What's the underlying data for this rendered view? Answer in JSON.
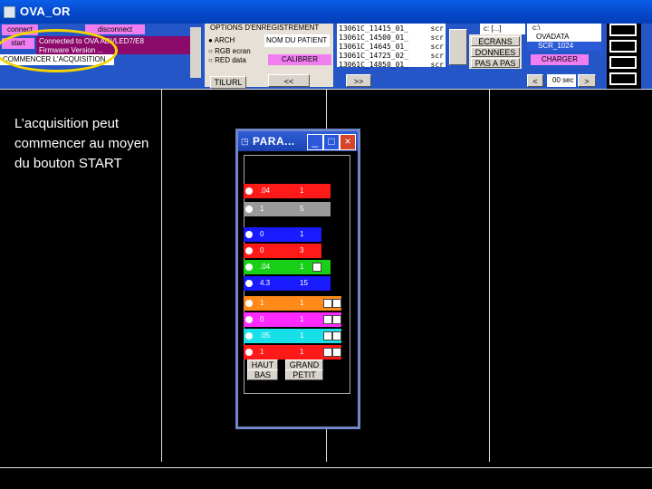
{
  "app": {
    "title": "OVA_OR"
  },
  "toolbar": {
    "connect": "connect",
    "start": "start",
    "disconnect": "disconnect",
    "status_lines": [
      "Connected to OVA  ADVLED7/E8",
      "Firmware Version ..."
    ],
    "status_bottom": "COMMENCER L'ACQUISITION",
    "options_title": "OPTIONS D'ENREGISTREMENT",
    "radio_options": [
      "ARCH",
      "RGB ecran",
      "RED data"
    ],
    "nom_patient": "NOM DU PATIENT",
    "calibrer": "CALIBRER",
    "file_list": [
      {
        "name": "13061C_11415_01_",
        "ext": "scr"
      },
      {
        "name": "13061C_14500_01_",
        "ext": "scr"
      },
      {
        "name": "13061C_14645_01_",
        "ext": "scr"
      },
      {
        "name": "13061C_14725_02_",
        "ext": "scr"
      },
      {
        "name": "13061C_14850_01_",
        "ext": "scr"
      }
    ],
    "ecrans": "ECRANS",
    "donnees": "DONNEES",
    "pas_a_pas": "PAS A PAS",
    "drive": "c: [...]",
    "folders": [
      "c:\\",
      "OVADATA",
      "SCR_1024"
    ],
    "charger": "CHARGER",
    "nav_prev": "<<",
    "nav_next": ">>",
    "lt": "<",
    "gt": ">",
    "seconds": "00 sec",
    "title_field": "TILURL"
  },
  "note": "L’acquisition peut commencer au moyen du bouton START",
  "para": {
    "title": "PARA...",
    "rows": [
      {
        "a": ".04",
        "b": "1",
        "color": "#ff1a1a",
        "width": 96,
        "radio": true,
        "checks": 0
      },
      {
        "a": "1",
        "b": "5",
        "color": "#9a9a9a",
        "width": 96,
        "radio": true,
        "checks": 0
      },
      {
        "a": "0",
        "b": "1",
        "color": "#1a1aff",
        "width": 86,
        "radio": true,
        "checks": 0
      },
      {
        "a": "0",
        "b": "3",
        "color": "#ff1a1a",
        "width": 86,
        "radio": true,
        "checks": 0
      },
      {
        "a": ".04",
        "b": "1",
        "color": "#18d018",
        "width": 96,
        "radio": true,
        "checks": 1
      },
      {
        "a": "4.3",
        "b": "15",
        "color": "#1a1aff",
        "width": 96,
        "radio": true,
        "checks": 0
      },
      {
        "a": "1",
        "b": "1",
        "color": "#ff8a1a",
        "width": 108,
        "radio": true,
        "checks": 2
      },
      {
        "a": "0",
        "b": "1",
        "color": "#ff2aff",
        "width": 108,
        "radio": true,
        "checks": 2
      },
      {
        "a": ".05",
        "b": "1",
        "color": "#18e0e8",
        "width": 108,
        "radio": true,
        "checks": 2
      },
      {
        "a": "1",
        "b": "1",
        "color": "#ff1a1a",
        "width": 108,
        "radio": true,
        "checks": 2
      }
    ],
    "haut": "HAUT",
    "bas": "BAS",
    "grand": "GRAND",
    "petit": "PETIT"
  }
}
